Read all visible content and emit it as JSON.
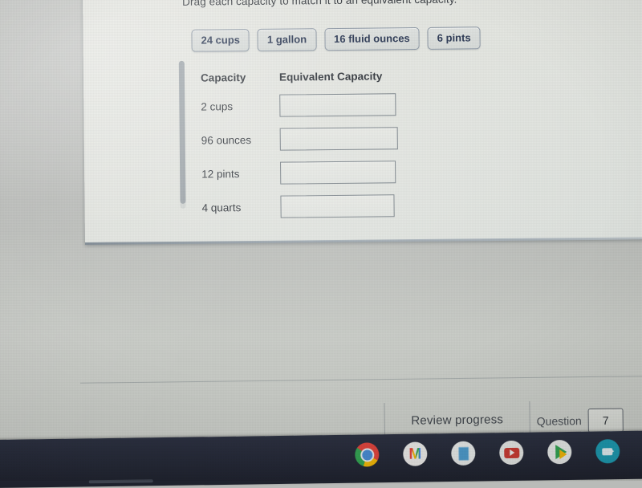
{
  "instruction": "Drag each capacity to match it to an equivalent capacity.",
  "chips": [
    {
      "label": "24 cups"
    },
    {
      "label": "1 gallon"
    },
    {
      "label": "16 fluid ounces"
    },
    {
      "label": "6 pints"
    }
  ],
  "table": {
    "headers": {
      "capacity": "Capacity",
      "equivalent": "Equivalent Capacity"
    },
    "rows": [
      {
        "capacity": "2 cups",
        "equivalent": ""
      },
      {
        "capacity": "96 ounces",
        "equivalent": ""
      },
      {
        "capacity": "12 pints",
        "equivalent": ""
      },
      {
        "capacity": "4 quarts",
        "equivalent": ""
      }
    ]
  },
  "footer": {
    "review_label": "Review progress",
    "question_label": "Question",
    "question_number": "7"
  },
  "shelf": {
    "icons": [
      {
        "name": "chrome-icon"
      },
      {
        "name": "gmail-icon"
      },
      {
        "name": "google-docs-icon"
      },
      {
        "name": "youtube-icon"
      },
      {
        "name": "play-store-icon"
      },
      {
        "name": "zoom-icon"
      }
    ]
  },
  "colors": {
    "chip_text": "#2d3a55",
    "chip_border": "#8e99a6",
    "panel_bg": "#e6e8e3",
    "shelf_bg": "#242836",
    "box_border": "#767f86"
  }
}
